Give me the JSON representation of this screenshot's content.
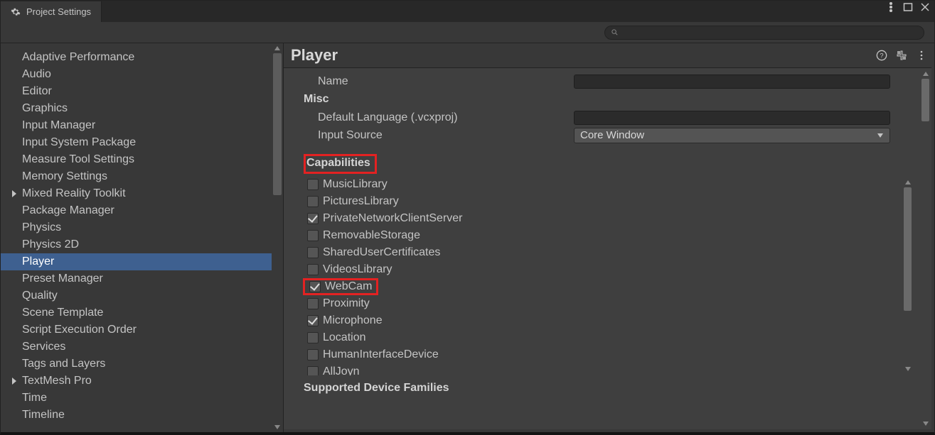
{
  "window": {
    "tab_title": "Project Settings"
  },
  "search": {
    "placeholder": ""
  },
  "sidebar": {
    "items": [
      {
        "label": "Adaptive Performance",
        "expandable": false
      },
      {
        "label": "Audio",
        "expandable": false
      },
      {
        "label": "Editor",
        "expandable": false
      },
      {
        "label": "Graphics",
        "expandable": false
      },
      {
        "label": "Input Manager",
        "expandable": false
      },
      {
        "label": "Input System Package",
        "expandable": false
      },
      {
        "label": "Measure Tool Settings",
        "expandable": false
      },
      {
        "label": "Memory Settings",
        "expandable": false
      },
      {
        "label": "Mixed Reality Toolkit",
        "expandable": true
      },
      {
        "label": "Package Manager",
        "expandable": false
      },
      {
        "label": "Physics",
        "expandable": false
      },
      {
        "label": "Physics 2D",
        "expandable": false
      },
      {
        "label": "Player",
        "expandable": false,
        "selected": true
      },
      {
        "label": "Preset Manager",
        "expandable": false
      },
      {
        "label": "Quality",
        "expandable": false
      },
      {
        "label": "Scene Template",
        "expandable": false
      },
      {
        "label": "Script Execution Order",
        "expandable": false
      },
      {
        "label": "Services",
        "expandable": false
      },
      {
        "label": "Tags and Layers",
        "expandable": false
      },
      {
        "label": "TextMesh Pro",
        "expandable": true
      },
      {
        "label": "Time",
        "expandable": false
      },
      {
        "label": "Timeline",
        "expandable": false
      }
    ]
  },
  "main": {
    "title": "Player",
    "name_field": {
      "label": "Name",
      "value": ""
    },
    "misc": {
      "heading": "Misc",
      "default_language": {
        "label": "Default Language (.vcxproj)",
        "value": ""
      },
      "input_source": {
        "label": "Input Source",
        "value": "Core Window"
      }
    },
    "capabilities": {
      "heading": "Capabilities",
      "items": [
        {
          "label": "MusicLibrary",
          "checked": false
        },
        {
          "label": "PicturesLibrary",
          "checked": false
        },
        {
          "label": "PrivateNetworkClientServer",
          "checked": true
        },
        {
          "label": "RemovableStorage",
          "checked": false
        },
        {
          "label": "SharedUserCertificates",
          "checked": false
        },
        {
          "label": "VideosLibrary",
          "checked": false
        },
        {
          "label": "WebCam",
          "checked": true,
          "highlight": true
        },
        {
          "label": "Proximity",
          "checked": false
        },
        {
          "label": "Microphone",
          "checked": true
        },
        {
          "label": "Location",
          "checked": false
        },
        {
          "label": "HumanInterfaceDevice",
          "checked": false
        },
        {
          "label": "AllJoyn",
          "checked": false
        }
      ]
    },
    "supported_families": {
      "heading": "Supported Device Families"
    }
  }
}
